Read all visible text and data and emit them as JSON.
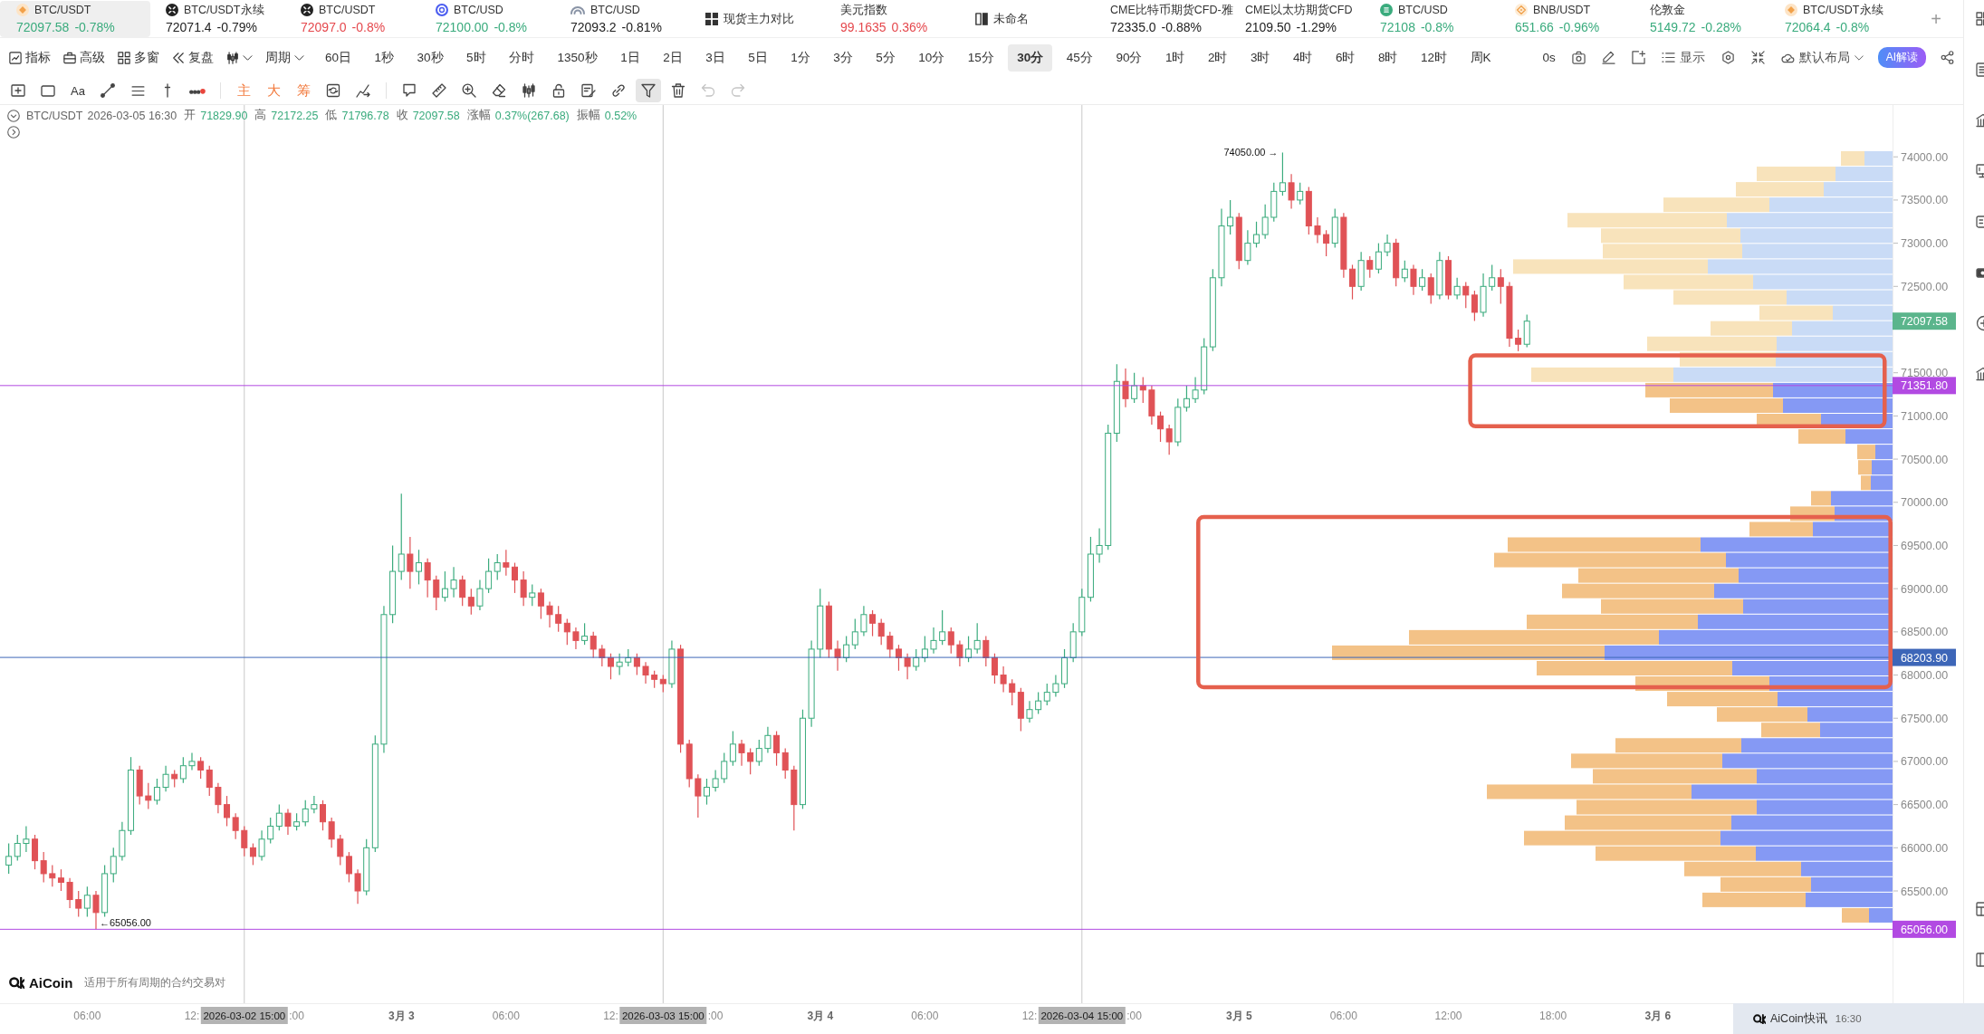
{
  "tickers": [
    {
      "kind": "coin",
      "name": "BTC/USDT",
      "price": "72097.58",
      "change": "-0.78%",
      "color": "#3aab7d",
      "selected": true
    },
    {
      "kind": "xcircle",
      "name": "BTC/USDT永续",
      "price": "72071.4",
      "change": "-0.79%",
      "color": "#222222",
      "selected": false
    },
    {
      "kind": "xcircle",
      "name": "BTC/USDT",
      "price": "72097.0",
      "change": "-0.8%",
      "color": "#e5484d",
      "selected": false
    },
    {
      "kind": "ring",
      "name": "BTC/USD",
      "price": "72100.00",
      "change": "-0.8%",
      "color": "#3aab7d",
      "selected": false
    },
    {
      "kind": "arc",
      "name": "BTC/USD",
      "price": "72093.2",
      "change": "-0.81%",
      "color": "#222222",
      "selected": false
    },
    {
      "kind": "grid",
      "name": "现货主力对比",
      "selected": false
    },
    {
      "kind": "plain",
      "name": "美元指数",
      "price": "99.1635",
      "change": "0.36%",
      "color": "#e5484d",
      "selected": false
    },
    {
      "kind": "split",
      "name": "未命名",
      "selected": false
    },
    {
      "kind": "plain",
      "name": "CME比特币期货CFD-雅",
      "price": "72335.0",
      "change": "-0.88%",
      "color": "#222222",
      "selected": false
    },
    {
      "kind": "plain",
      "name": "CME以太坊期货CFD",
      "price": "2109.50",
      "change": "-1.29%",
      "color": "#222222",
      "selected": false
    },
    {
      "kind": "bitcoin",
      "name": "BTC/USD",
      "price": "72108",
      "change": "-0.8%",
      "color": "#3aab7d",
      "selected": false
    },
    {
      "kind": "bnb",
      "name": "BNB/USDT",
      "price": "651.66",
      "change": "-0.96%",
      "color": "#3aab7d",
      "selected": false
    },
    {
      "kind": "plain",
      "name": "伦敦金",
      "price": "5149.72",
      "change": "-0.28%",
      "color": "#3aab7d",
      "selected": false
    },
    {
      "kind": "coin",
      "name": "BTC/USDT永续",
      "price": "72064.4",
      "change": "-0.8%",
      "color": "#3aab7d",
      "selected": false
    }
  ],
  "add_tab": {
    "label": "+"
  },
  "toolbar": {
    "menus": [
      {
        "kind": "indicator",
        "label": "指标"
      },
      {
        "kind": "advanced",
        "label": "高级"
      },
      {
        "kind": "multi",
        "label": "多窗"
      },
      {
        "kind": "replay",
        "label": "复盘"
      },
      {
        "kind": "chart-type"
      },
      {
        "kind": "period",
        "label": "周期"
      }
    ],
    "periods": [
      {
        "label": "60日",
        "selected": false
      },
      {
        "label": "1秒",
        "selected": false
      },
      {
        "label": "30秒",
        "selected": false
      },
      {
        "label": "5时",
        "selected": false
      },
      {
        "label": "分时",
        "selected": false
      },
      {
        "label": "1350秒",
        "selected": false
      },
      {
        "label": "1日",
        "selected": false
      },
      {
        "label": "2日",
        "selected": false
      },
      {
        "label": "3日",
        "selected": false
      },
      {
        "label": "5日",
        "selected": false
      },
      {
        "label": "1分",
        "selected": false
      },
      {
        "label": "3分",
        "selected": false
      },
      {
        "label": "5分",
        "selected": false
      },
      {
        "label": "10分",
        "selected": false
      },
      {
        "label": "15分",
        "selected": false
      },
      {
        "label": "30分",
        "selected": true
      },
      {
        "label": "45分",
        "selected": false
      },
      {
        "label": "90分",
        "selected": false
      },
      {
        "label": "1时",
        "selected": false
      },
      {
        "label": "2时",
        "selected": false
      },
      {
        "label": "3时",
        "selected": false
      },
      {
        "label": "4时",
        "selected": false
      },
      {
        "label": "6时",
        "selected": false
      },
      {
        "label": "8时",
        "selected": false
      },
      {
        "label": "12时",
        "selected": false
      },
      {
        "label": "周K",
        "selected": false
      }
    ],
    "countdown": "0s",
    "actions": [
      {
        "kind": "camera"
      },
      {
        "kind": "pen"
      },
      {
        "kind": "note"
      },
      {
        "kind": "display",
        "label": "显示"
      },
      {
        "kind": "settings"
      },
      {
        "kind": "collapse"
      },
      {
        "kind": "layout",
        "label": "默认布局"
      },
      {
        "kind": "ai",
        "label": "AI解读"
      },
      {
        "kind": "share"
      }
    ]
  },
  "tool_groups": [
    [
      {
        "kind": "frame",
        "selected": false,
        "disabled": false
      },
      {
        "kind": "rect",
        "selected": false,
        "disabled": false
      },
      {
        "kind": "text",
        "label": "Aa",
        "color": "#333333",
        "selected": false,
        "disabled": false
      },
      {
        "kind": "line",
        "selected": false,
        "disabled": false
      },
      {
        "kind": "hlines",
        "selected": false,
        "disabled": false
      },
      {
        "kind": "vline",
        "selected": false,
        "disabled": false
      },
      {
        "kind": "more",
        "selected": false,
        "disabled": false
      }
    ],
    [
      {
        "kind": "label",
        "label": "主",
        "color": "#f27a3d",
        "selected": false,
        "disabled": false
      },
      {
        "kind": "label",
        "label": "大",
        "color": "#f27a3d",
        "selected": false,
        "disabled": false
      },
      {
        "kind": "label",
        "label": "筹",
        "color": "#f27a3d",
        "selected": false,
        "disabled": false
      },
      {
        "kind": "cycle",
        "selected": false,
        "disabled": false
      },
      {
        "kind": "trend",
        "selected": false,
        "disabled": false
      }
    ],
    [
      {
        "kind": "callout",
        "selected": false,
        "disabled": false
      },
      {
        "kind": "ruler",
        "selected": false,
        "disabled": false
      },
      {
        "kind": "zoom",
        "selected": false,
        "disabled": false
      },
      {
        "kind": "eraser",
        "selected": false,
        "disabled": false
      },
      {
        "kind": "candles",
        "selected": false,
        "disabled": false
      },
      {
        "kind": "lock",
        "selected": false,
        "disabled": false
      },
      {
        "kind": "edit",
        "selected": false,
        "disabled": false
      },
      {
        "kind": "link",
        "selected": false,
        "disabled": false
      },
      {
        "kind": "filter",
        "selected": true,
        "disabled": false
      },
      {
        "kind": "trash",
        "selected": false,
        "disabled": false
      },
      {
        "kind": "undo",
        "selected": false,
        "disabled": true
      },
      {
        "kind": "redo",
        "selected": false,
        "disabled": true
      }
    ]
  ],
  "info": {
    "symbol": "BTC/USDT",
    "time": "2026-03-05 16:30",
    "fields": [
      {
        "label": "开",
        "value": "71829.90"
      },
      {
        "label": "高",
        "value": "72172.25"
      },
      {
        "label": "低",
        "value": "71796.78"
      },
      {
        "label": "收",
        "value": "72097.58"
      },
      {
        "label": "涨幅",
        "value": "0.37%(267.68)"
      },
      {
        "label": "振幅",
        "value": "0.52%"
      }
    ]
  },
  "chart": {
    "chart_data": [
      {
        "type": "candlestick",
        "xlim": [
          "2026-03-02T01:00",
          "2026-03-06T17:30"
        ],
        "ylim": [
          64200,
          74600
        ],
        "x": [
          "2026-03-02T01:30",
          "2026-03-02T02:00",
          "2026-03-02T02:30",
          "2026-03-02T03:00",
          "2026-03-02T03:30",
          "2026-03-02T04:00",
          "2026-03-02T04:30",
          "2026-03-02T05:00",
          "2026-03-02T05:30",
          "2026-03-02T06:00",
          "2026-03-02T06:30",
          "2026-03-02T07:00",
          "2026-03-02T07:30",
          "2026-03-02T08:00",
          "2026-03-02T08:30",
          "2026-03-02T09:00",
          "2026-03-02T09:30",
          "2026-03-02T10:00",
          "2026-03-02T10:30",
          "2026-03-02T11:00",
          "2026-03-02T11:30",
          "2026-03-02T12:00",
          "2026-03-02T12:30",
          "2026-03-02T13:00",
          "2026-03-02T13:30",
          "2026-03-02T14:00",
          "2026-03-02T14:30",
          "2026-03-02T15:00",
          "2026-03-02T15:30",
          "2026-03-02T16:00",
          "2026-03-02T16:30",
          "2026-03-02T17:00",
          "2026-03-02T17:30",
          "2026-03-02T18:00",
          "2026-03-02T18:30",
          "2026-03-02T19:00",
          "2026-03-02T19:30",
          "2026-03-02T20:00",
          "2026-03-02T20:30",
          "2026-03-02T21:00",
          "2026-03-02T21:30",
          "2026-03-02T22:00",
          "2026-03-02T22:30",
          "2026-03-02T23:00",
          "2026-03-02T23:30",
          "2026-03-03T00:00",
          "2026-03-03T00:30",
          "2026-03-03T01:00",
          "2026-03-03T01:30",
          "2026-03-03T02:00",
          "2026-03-03T02:30",
          "2026-03-03T03:00",
          "2026-03-03T03:30",
          "2026-03-03T04:00",
          "2026-03-03T04:30",
          "2026-03-03T05:00",
          "2026-03-03T05:30",
          "2026-03-03T06:00",
          "2026-03-03T06:30",
          "2026-03-03T07:00",
          "2026-03-03T07:30",
          "2026-03-03T08:00",
          "2026-03-03T08:30",
          "2026-03-03T09:00",
          "2026-03-03T09:30",
          "2026-03-03T10:00",
          "2026-03-03T10:30",
          "2026-03-03T11:00",
          "2026-03-03T11:30",
          "2026-03-03T12:00",
          "2026-03-03T12:30",
          "2026-03-03T13:00",
          "2026-03-03T13:30",
          "2026-03-03T14:00",
          "2026-03-03T14:30",
          "2026-03-03T15:00",
          "2026-03-03T15:30",
          "2026-03-03T16:00",
          "2026-03-03T16:30",
          "2026-03-03T17:00",
          "2026-03-03T17:30",
          "2026-03-03T18:00",
          "2026-03-03T18:30",
          "2026-03-03T19:00",
          "2026-03-03T19:30",
          "2026-03-03T20:00",
          "2026-03-03T20:30",
          "2026-03-03T21:00",
          "2026-03-03T21:30",
          "2026-03-03T22:00",
          "2026-03-03T22:30",
          "2026-03-03T23:00",
          "2026-03-03T23:30",
          "2026-03-04T00:00",
          "2026-03-04T00:30",
          "2026-03-04T01:00",
          "2026-03-04T01:30",
          "2026-03-04T02:00",
          "2026-03-04T02:30",
          "2026-03-04T03:00",
          "2026-03-04T03:30",
          "2026-03-04T04:00",
          "2026-03-04T04:30",
          "2026-03-04T05:00",
          "2026-03-04T05:30",
          "2026-03-04T06:00",
          "2026-03-04T06:30",
          "2026-03-04T07:00",
          "2026-03-04T07:30",
          "2026-03-04T08:00",
          "2026-03-04T08:30",
          "2026-03-04T09:00",
          "2026-03-04T09:30",
          "2026-03-04T10:00",
          "2026-03-04T10:30",
          "2026-03-04T11:00",
          "2026-03-04T11:30",
          "2026-03-04T12:00",
          "2026-03-04T12:30",
          "2026-03-04T13:00",
          "2026-03-04T13:30",
          "2026-03-04T14:00",
          "2026-03-04T14:30",
          "2026-03-04T15:00",
          "2026-03-04T15:30",
          "2026-03-04T16:00",
          "2026-03-04T16:30",
          "2026-03-04T17:00",
          "2026-03-04T17:30",
          "2026-03-04T18:00",
          "2026-03-04T18:30",
          "2026-03-04T19:00",
          "2026-03-04T19:30",
          "2026-03-04T20:00",
          "2026-03-04T20:30",
          "2026-03-04T21:00",
          "2026-03-04T21:30",
          "2026-03-04T22:00",
          "2026-03-04T22:30",
          "2026-03-04T23:00",
          "2026-03-04T23:30",
          "2026-03-05T00:00",
          "2026-03-05T00:30",
          "2026-03-05T01:00",
          "2026-03-05T01:30",
          "2026-03-05T02:00",
          "2026-03-05T02:30",
          "2026-03-05T03:00",
          "2026-03-05T03:30",
          "2026-03-05T04:00",
          "2026-03-05T04:30",
          "2026-03-05T05:00",
          "2026-03-05T05:30",
          "2026-03-05T06:00",
          "2026-03-05T06:30",
          "2026-03-05T07:00",
          "2026-03-05T07:30",
          "2026-03-05T08:00",
          "2026-03-05T08:30",
          "2026-03-05T09:00",
          "2026-03-05T09:30",
          "2026-03-05T10:00",
          "2026-03-05T10:30",
          "2026-03-05T11:00",
          "2026-03-05T11:30",
          "2026-03-05T12:00",
          "2026-03-05T12:30",
          "2026-03-05T13:00",
          "2026-03-05T13:30",
          "2026-03-05T14:00",
          "2026-03-05T14:30",
          "2026-03-05T15:00",
          "2026-03-05T15:30",
          "2026-03-05T16:00",
          "2026-03-05T16:30"
        ],
        "ohlc": [
          [
            65800,
            66050,
            65700,
            65900
          ],
          [
            65900,
            66150,
            65850,
            66050
          ],
          [
            66050,
            66250,
            65950,
            66100
          ],
          [
            66100,
            66150,
            65750,
            65850
          ],
          [
            65850,
            65950,
            65600,
            65700
          ],
          [
            65700,
            65800,
            65550,
            65650
          ],
          [
            65650,
            65750,
            65500,
            65600
          ],
          [
            65600,
            65650,
            65300,
            65400
          ],
          [
            65400,
            65500,
            65200,
            65300
          ],
          [
            65300,
            65550,
            65200,
            65450
          ],
          [
            65450,
            65500,
            65056,
            65250
          ],
          [
            65250,
            65800,
            65200,
            65700
          ],
          [
            65700,
            66000,
            65600,
            65900
          ],
          [
            65900,
            66300,
            65850,
            66200
          ],
          [
            66200,
            67050,
            66150,
            66900
          ],
          [
            66900,
            66950,
            66500,
            66600
          ],
          [
            66600,
            66750,
            66450,
            66550
          ],
          [
            66550,
            66800,
            66500,
            66700
          ],
          [
            66700,
            66950,
            66650,
            66850
          ],
          [
            66850,
            66900,
            66700,
            66800
          ],
          [
            66800,
            67050,
            66750,
            66950
          ],
          [
            66950,
            67100,
            66900,
            67000
          ],
          [
            67000,
            67050,
            66800,
            66900
          ],
          [
            66900,
            66950,
            66600,
            66700
          ],
          [
            66700,
            66750,
            66400,
            66500
          ],
          [
            66500,
            66600,
            66250,
            66350
          ],
          [
            66350,
            66400,
            66100,
            66200
          ],
          [
            66200,
            66250,
            65900,
            66000
          ],
          [
            66000,
            66050,
            65800,
            65900
          ],
          [
            65900,
            66200,
            65850,
            66100
          ],
          [
            66100,
            66350,
            66050,
            66250
          ],
          [
            66250,
            66500,
            66200,
            66400
          ],
          [
            66400,
            66450,
            66150,
            66250
          ],
          [
            66250,
            66400,
            66200,
            66300
          ],
          [
            66300,
            66550,
            66250,
            66450
          ],
          [
            66450,
            66600,
            66400,
            66500
          ],
          [
            66500,
            66550,
            66200,
            66300
          ],
          [
            66300,
            66350,
            66000,
            66100
          ],
          [
            66100,
            66150,
            65800,
            65900
          ],
          [
            65900,
            65950,
            65600,
            65700
          ],
          [
            65700,
            65750,
            65350,
            65500
          ],
          [
            65500,
            66100,
            65450,
            66000
          ],
          [
            66000,
            67300,
            65950,
            67200
          ],
          [
            67200,
            68800,
            67100,
            68700
          ],
          [
            68700,
            69500,
            68600,
            69200
          ],
          [
            69200,
            70100,
            69100,
            69400
          ],
          [
            69400,
            69600,
            69000,
            69200
          ],
          [
            69200,
            69450,
            69050,
            69300
          ],
          [
            69300,
            69350,
            68900,
            69100
          ],
          [
            69100,
            69150,
            68750,
            68900
          ],
          [
            68900,
            69200,
            68850,
            69000
          ],
          [
            69000,
            69250,
            68900,
            69100
          ],
          [
            69100,
            69150,
            68800,
            68900
          ],
          [
            68900,
            69000,
            68700,
            68800
          ],
          [
            68800,
            69100,
            68750,
            69000
          ],
          [
            69000,
            69350,
            68950,
            69200
          ],
          [
            69200,
            69400,
            69100,
            69300
          ],
          [
            69300,
            69450,
            69150,
            69250
          ],
          [
            69250,
            69300,
            68950,
            69100
          ],
          [
            69100,
            69200,
            68800,
            68900
          ],
          [
            68900,
            69050,
            68800,
            68950
          ],
          [
            68950,
            69000,
            68650,
            68800
          ],
          [
            68800,
            68850,
            68550,
            68700
          ],
          [
            68700,
            68800,
            68500,
            68600
          ],
          [
            68600,
            68650,
            68350,
            68500
          ],
          [
            68500,
            68550,
            68300,
            68400
          ],
          [
            68400,
            68600,
            68350,
            68450
          ],
          [
            68450,
            68500,
            68200,
            68300
          ],
          [
            68300,
            68350,
            68100,
            68200
          ],
          [
            68200,
            68250,
            67950,
            68100
          ],
          [
            68100,
            68250,
            68000,
            68150
          ],
          [
            68150,
            68300,
            68100,
            68200
          ],
          [
            68200,
            68250,
            68000,
            68100
          ],
          [
            68100,
            68150,
            67900,
            68000
          ],
          [
            68000,
            68050,
            67850,
            67950
          ],
          [
            67950,
            68000,
            67800,
            67900
          ],
          [
            67900,
            68400,
            67850,
            68300
          ],
          [
            68300,
            68350,
            67100,
            67200
          ],
          [
            67200,
            67250,
            66700,
            66800
          ],
          [
            66800,
            66850,
            66350,
            66600
          ],
          [
            66600,
            66800,
            66500,
            66700
          ],
          [
            66700,
            66900,
            66650,
            66800
          ],
          [
            66800,
            67100,
            66750,
            67000
          ],
          [
            67000,
            67350,
            66950,
            67200
          ],
          [
            67200,
            67250,
            66950,
            67100
          ],
          [
            67100,
            67150,
            66850,
            67000
          ],
          [
            67000,
            67250,
            66950,
            67150
          ],
          [
            67150,
            67400,
            67100,
            67300
          ],
          [
            67300,
            67350,
            66950,
            67100
          ],
          [
            67100,
            67150,
            66800,
            66900
          ],
          [
            66900,
            66950,
            66200,
            66500
          ],
          [
            66500,
            67600,
            66450,
            67500
          ],
          [
            67500,
            68400,
            67400,
            68300
          ],
          [
            68300,
            69000,
            68200,
            68800
          ],
          [
            68800,
            68850,
            68200,
            68300
          ],
          [
            68300,
            68400,
            68050,
            68200
          ],
          [
            68200,
            68450,
            68150,
            68350
          ],
          [
            68350,
            68650,
            68300,
            68500
          ],
          [
            68500,
            68800,
            68450,
            68700
          ],
          [
            68700,
            68750,
            68450,
            68600
          ],
          [
            68600,
            68650,
            68350,
            68450
          ],
          [
            68450,
            68500,
            68200,
            68300
          ],
          [
            68300,
            68350,
            68050,
            68200
          ],
          [
            68200,
            68250,
            67950,
            68100
          ],
          [
            68100,
            68300,
            68050,
            68200
          ],
          [
            68200,
            68450,
            68150,
            68300
          ],
          [
            68300,
            68550,
            68250,
            68400
          ],
          [
            68400,
            68750,
            68350,
            68500
          ],
          [
            68500,
            68550,
            68250,
            68350
          ],
          [
            68350,
            68400,
            68100,
            68200
          ],
          [
            68200,
            68450,
            68150,
            68300
          ],
          [
            68300,
            68600,
            68250,
            68400
          ],
          [
            68400,
            68450,
            68100,
            68200
          ],
          [
            68200,
            68250,
            67900,
            68000
          ],
          [
            68000,
            68100,
            67800,
            67900
          ],
          [
            67900,
            67950,
            67650,
            67800
          ],
          [
            67800,
            67850,
            67350,
            67500
          ],
          [
            67500,
            67700,
            67450,
            67600
          ],
          [
            67600,
            67800,
            67550,
            67700
          ],
          [
            67700,
            67900,
            67650,
            67800
          ],
          [
            67800,
            68000,
            67750,
            67900
          ],
          [
            67900,
            68300,
            67850,
            68200
          ],
          [
            68200,
            68600,
            68150,
            68500
          ],
          [
            68500,
            69000,
            68450,
            68900
          ],
          [
            68900,
            69600,
            68850,
            69400
          ],
          [
            69400,
            69700,
            69300,
            69500
          ],
          [
            69500,
            70900,
            69450,
            70800
          ],
          [
            70800,
            71600,
            70700,
            71400
          ],
          [
            71400,
            71550,
            71100,
            71200
          ],
          [
            71200,
            71500,
            71150,
            71350
          ],
          [
            71350,
            71450,
            71150,
            71300
          ],
          [
            71300,
            71350,
            70900,
            71000
          ],
          [
            71000,
            71050,
            70700,
            70850
          ],
          [
            70850,
            70900,
            70550,
            70700
          ],
          [
            70700,
            71200,
            70650,
            71100
          ],
          [
            71100,
            71350,
            71050,
            71200
          ],
          [
            71200,
            71450,
            71150,
            71300
          ],
          [
            71300,
            71900,
            71250,
            71800
          ],
          [
            71800,
            72700,
            71750,
            72600
          ],
          [
            72600,
            73400,
            72500,
            73200
          ],
          [
            73200,
            73500,
            73100,
            73300
          ],
          [
            73300,
            73350,
            72700,
            72800
          ],
          [
            72800,
            73150,
            72750,
            73000
          ],
          [
            73000,
            73250,
            72950,
            73100
          ],
          [
            73100,
            73450,
            73050,
            73300
          ],
          [
            73300,
            73700,
            73250,
            73600
          ],
          [
            73600,
            74050,
            73550,
            73700
          ],
          [
            73700,
            73800,
            73400,
            73500
          ],
          [
            73500,
            73700,
            73450,
            73600
          ],
          [
            73600,
            73650,
            73100,
            73200
          ],
          [
            73200,
            73300,
            73000,
            73100
          ],
          [
            73100,
            73150,
            72850,
            73000
          ],
          [
            73000,
            73400,
            72950,
            73300
          ],
          [
            73300,
            73350,
            72600,
            72700
          ],
          [
            72700,
            72750,
            72350,
            72500
          ],
          [
            72500,
            72900,
            72450,
            72800
          ],
          [
            72800,
            72850,
            72600,
            72700
          ],
          [
            72700,
            73000,
            72650,
            72900
          ],
          [
            72900,
            73100,
            72850,
            73000
          ],
          [
            73000,
            73050,
            72500,
            72600
          ],
          [
            72600,
            72800,
            72550,
            72700
          ],
          [
            72700,
            72750,
            72400,
            72500
          ],
          [
            72500,
            72700,
            72450,
            72600
          ],
          [
            72600,
            72650,
            72300,
            72400
          ],
          [
            72400,
            72900,
            72350,
            72800
          ],
          [
            72800,
            72850,
            72350,
            72400
          ],
          [
            72400,
            72600,
            72350,
            72500
          ],
          [
            72500,
            72550,
            72250,
            72400
          ],
          [
            72400,
            72450,
            72100,
            72200
          ],
          [
            72200,
            72650,
            72150,
            72500
          ],
          [
            72500,
            72750,
            72450,
            72600
          ],
          [
            72600,
            72700,
            72300,
            72500
          ],
          [
            72500,
            72550,
            71800,
            71900
          ],
          [
            71900,
            72000,
            71750,
            71830
          ],
          [
            71829.9,
            72172.25,
            71796.78,
            72097.58
          ]
        ],
        "xticks": [
          {
            "value": "2026-03-02T06:00",
            "label": "06:00"
          },
          {
            "value": "2026-03-02T12:00",
            "label": "12:"
          },
          {
            "value": "2026-03-02T18:00",
            "label": ":00"
          },
          {
            "value": "2026-03-03T00:00",
            "label": "3月 3"
          },
          {
            "value": "2026-03-03T06:00",
            "label": "06:00"
          },
          {
            "value": "2026-03-03T12:00",
            "label": "12:"
          },
          {
            "value": "2026-03-03T18:00",
            "label": ":00"
          },
          {
            "value": "2026-03-04T00:00",
            "label": "3月 4"
          },
          {
            "value": "2026-03-04T06:00",
            "label": "06:00"
          },
          {
            "value": "2026-03-04T12:00",
            "label": "12:"
          },
          {
            "value": "2026-03-04T18:00",
            "label": ":00"
          },
          {
            "value": "2026-03-05T00:00",
            "label": "3月 5"
          },
          {
            "value": "2026-03-05T06:00",
            "label": "06:00"
          },
          {
            "value": "2026-03-05T12:00",
            "label": "12:00"
          },
          {
            "value": "2026-03-05T18:00",
            "label": "18:00"
          },
          {
            "value": "2026-03-06T00:00",
            "label": "3月 6"
          }
        ],
        "yticks": [
          {
            "value": 74000,
            "label": "74000.00"
          },
          {
            "value": 73500,
            "label": "73500.00"
          },
          {
            "value": 73000,
            "label": "73000.00"
          },
          {
            "value": 72500,
            "label": "72500.00"
          },
          {
            "value": 71500,
            "label": "71500.00"
          },
          {
            "value": 71000,
            "label": "71000.00"
          },
          {
            "value": 70500,
            "label": "70500.00"
          },
          {
            "value": 70000,
            "label": "70000.00"
          },
          {
            "value": 69500,
            "label": "69500.00"
          },
          {
            "value": 69000,
            "label": "69000.00"
          },
          {
            "value": 68500,
            "label": "68500.00"
          },
          {
            "value": 68000,
            "label": "68000.00"
          },
          {
            "value": 67500,
            "label": "67500.00"
          },
          {
            "value": 67000,
            "label": "67000.00"
          },
          {
            "value": 66500,
            "label": "66500.00"
          },
          {
            "value": 66000,
            "label": "66000.00"
          },
          {
            "value": 65500,
            "label": "65500.00"
          }
        ],
        "ref_lines": [
          {
            "axis": "y",
            "value": 71351.8,
            "label": "71351.80",
            "color": "#b24ae2",
            "line_style": "solid"
          },
          {
            "axis": "y",
            "value": 68203.9,
            "label": "68203.90",
            "color": "#3d66b8",
            "line_style": "solid"
          },
          {
            "axis": "y",
            "value": 65056,
            "label": "65056.00",
            "color": "#b24ae2",
            "line_style": "solid"
          },
          {
            "axis": "x",
            "value": "2026-03-02T15:00",
            "label": "2026-03-02 15:00",
            "color": "#c8c8c8",
            "line_style": "solid"
          },
          {
            "axis": "x",
            "value": "2026-03-03T15:00",
            "label": "2026-03-03 15:00",
            "color": "#c8c8c8",
            "line_style": "solid"
          },
          {
            "axis": "x",
            "value": "2026-03-04T15:00",
            "label": "2026-03-04 15:00",
            "color": "#c8c8c8",
            "line_style": "solid"
          }
        ]
      }
    ],
    "last_price_tag": {
      "label": "72097.58"
    },
    "price_extremes": [
      {
        "kind": "high",
        "label": "74050.00 →"
      },
      {
        "kind": "low",
        "label": "←65056.00"
      }
    ]
  },
  "branding": {
    "name": "AiCoin",
    "note": "适用于所有周期的合约交易对"
  },
  "news": {
    "title": "AiCoin快讯",
    "time": "16:30"
  }
}
